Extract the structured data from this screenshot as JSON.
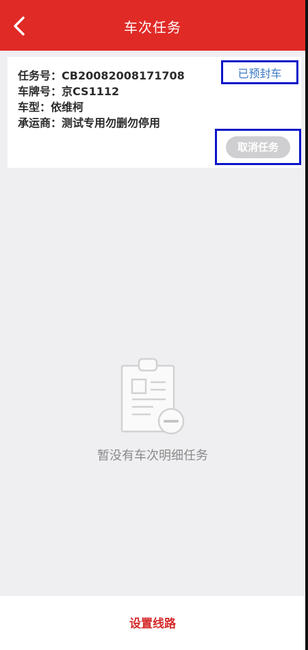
{
  "header": {
    "title": "车次任务"
  },
  "task": {
    "task_no": "任务号：CB20082008171708",
    "plate_no": "车牌号：京CS1112",
    "vehicle_type": "车型：依维柯",
    "carrier": "承运商：测试专用勿删勿停用",
    "status": "已预封车",
    "cancel_label": "取消任务"
  },
  "empty_state": {
    "icon": "clipboard-minus-icon",
    "message": "暂没有车次明细任务"
  },
  "footer": {
    "route_label": "设置线路"
  },
  "colors": {
    "header": "#e02a26",
    "status_text": "#3b78c3",
    "highlight_box": "#0a14c8",
    "cancel_button": "#cfcfd1",
    "route_text": "#d42a2a"
  }
}
